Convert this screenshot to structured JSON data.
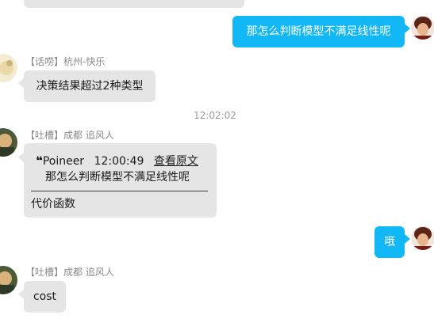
{
  "messages": {
    "top_outgoing": {
      "text": "那怎么判断模型不满足线性呢"
    },
    "msg1": {
      "sender": "【话唠】杭州-快乐",
      "text": "决策结果超过2种类型"
    },
    "timestamp": "12:02:02",
    "msg2": {
      "sender": "【吐槽】成都 追风人",
      "quote": {
        "mark": "❝",
        "author": "Poineer",
        "time": "12:00:49",
        "link": "查看原文",
        "text": "那怎么判断模型不满足线性呢"
      },
      "text": "代价函数"
    },
    "outgoing2": {
      "text": "哦"
    },
    "msg3": {
      "sender": "【吐槽】成都 追风人",
      "text": "cost"
    }
  },
  "colors": {
    "outgoing_bubble": "#12b7f5",
    "incoming_bubble": "#e5e5e5"
  },
  "icons": [
    "avatar-self",
    "avatar-hangzhou",
    "avatar-chengdu"
  ]
}
